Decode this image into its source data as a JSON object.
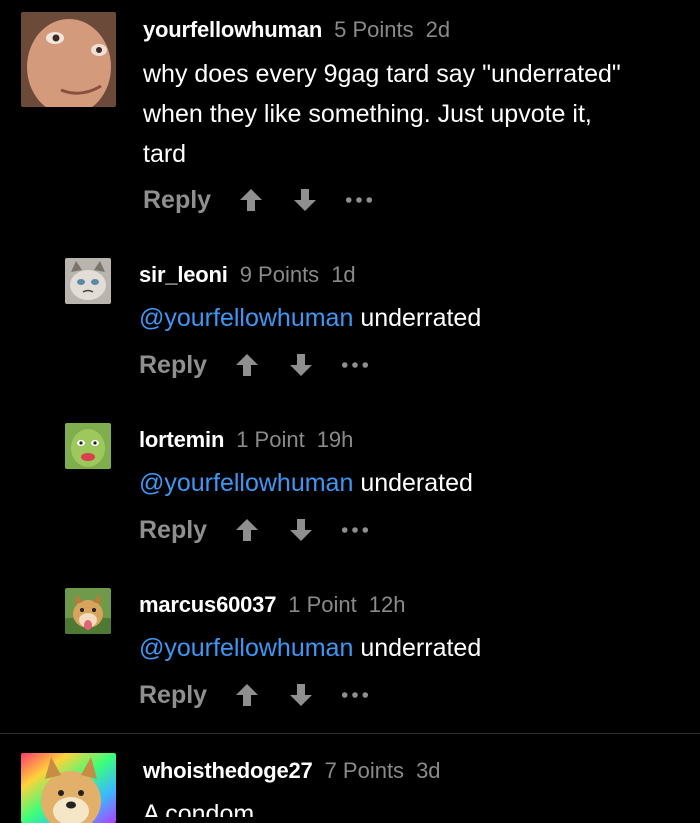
{
  "comments": [
    {
      "username": "yourfellowhuman",
      "points": "5 Points",
      "time": "2d",
      "text_lines": [
        "why does every 9gag tard say \"underrated\"",
        "when they like something. Just upvote it,",
        "tard"
      ],
      "reply_label": "Reply"
    },
    {
      "username": "sir_leoni",
      "points": "9 Points",
      "time": "1d",
      "mention": "@yourfellowhuman",
      "text": " underrated",
      "reply_label": "Reply"
    },
    {
      "username": "lortemin",
      "points": "1 Point",
      "time": "19h",
      "mention": "@yourfellowhuman",
      "text": " underated",
      "reply_label": "Reply"
    },
    {
      "username": "marcus60037",
      "points": "1 Point",
      "time": "12h",
      "mention": "@yourfellowhuman",
      "text": " underrated",
      "reply_label": "Reply"
    },
    {
      "username": "whoisthedoge27",
      "points": "7 Points",
      "time": "3d",
      "text": "A condom"
    }
  ],
  "icons": {
    "upvote": "arrow-up-icon",
    "downvote": "arrow-down-icon",
    "more": "more-options-icon"
  },
  "colors": {
    "background": "#000000",
    "mention": "#3e97f5",
    "muted": "#8a8a8a"
  }
}
